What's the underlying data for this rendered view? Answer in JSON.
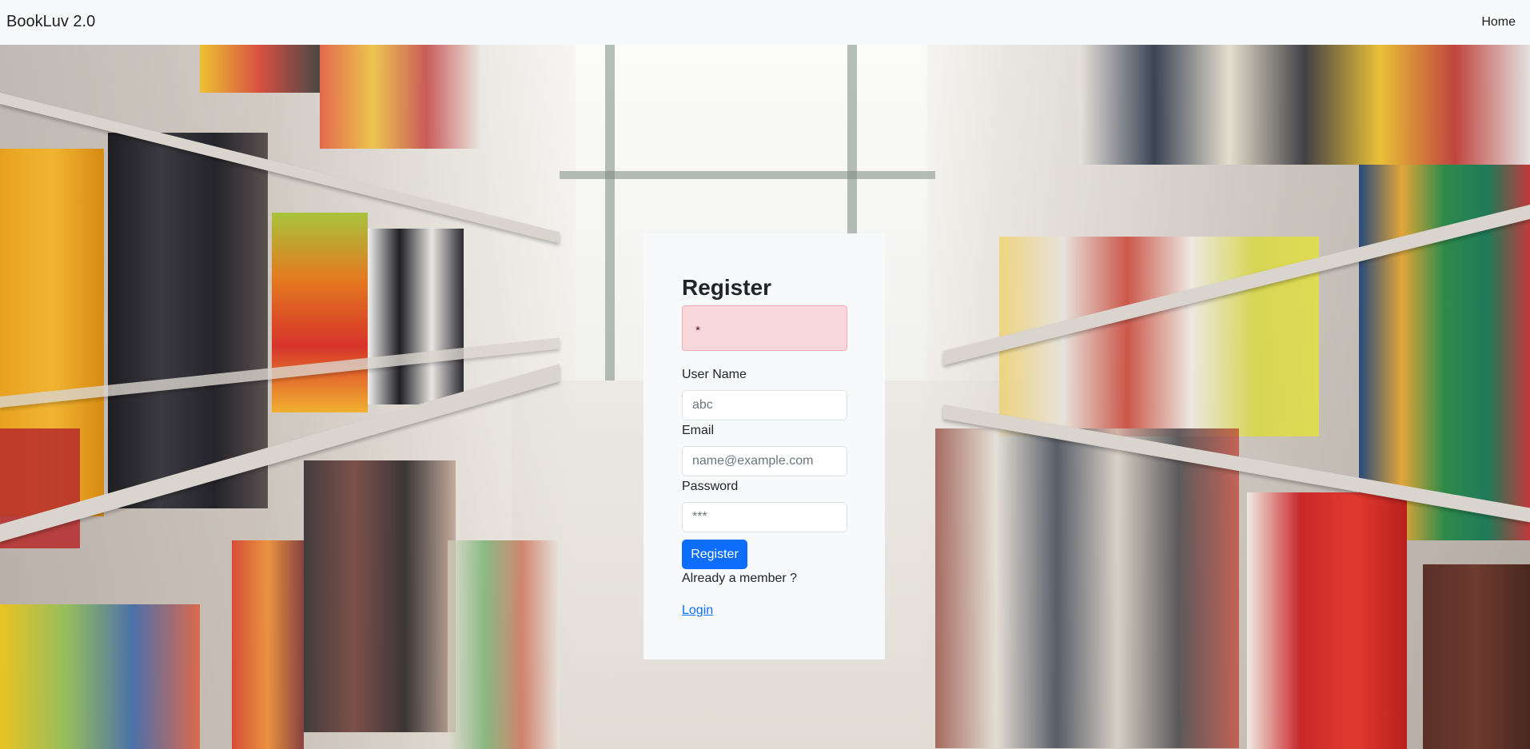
{
  "navbar": {
    "brand": "BookLuv 2.0",
    "home": "Home"
  },
  "form": {
    "title": "Register",
    "alert_text": "*",
    "username_label": "User Name",
    "username_placeholder": "abc",
    "email_label": "Email",
    "email_placeholder": "name@example.com",
    "password_label": "Password",
    "password_placeholder": "***",
    "submit_label": "Register",
    "member_text": "Already a member ?",
    "login_link": "Login"
  },
  "colors": {
    "navbar_bg": "#f8f9fa",
    "card_bg": "#f8f9fa",
    "alert_bg": "#f8d7da",
    "primary": "#0d6efd"
  },
  "background": {
    "description_icon": "library-bookshelves-photo"
  }
}
